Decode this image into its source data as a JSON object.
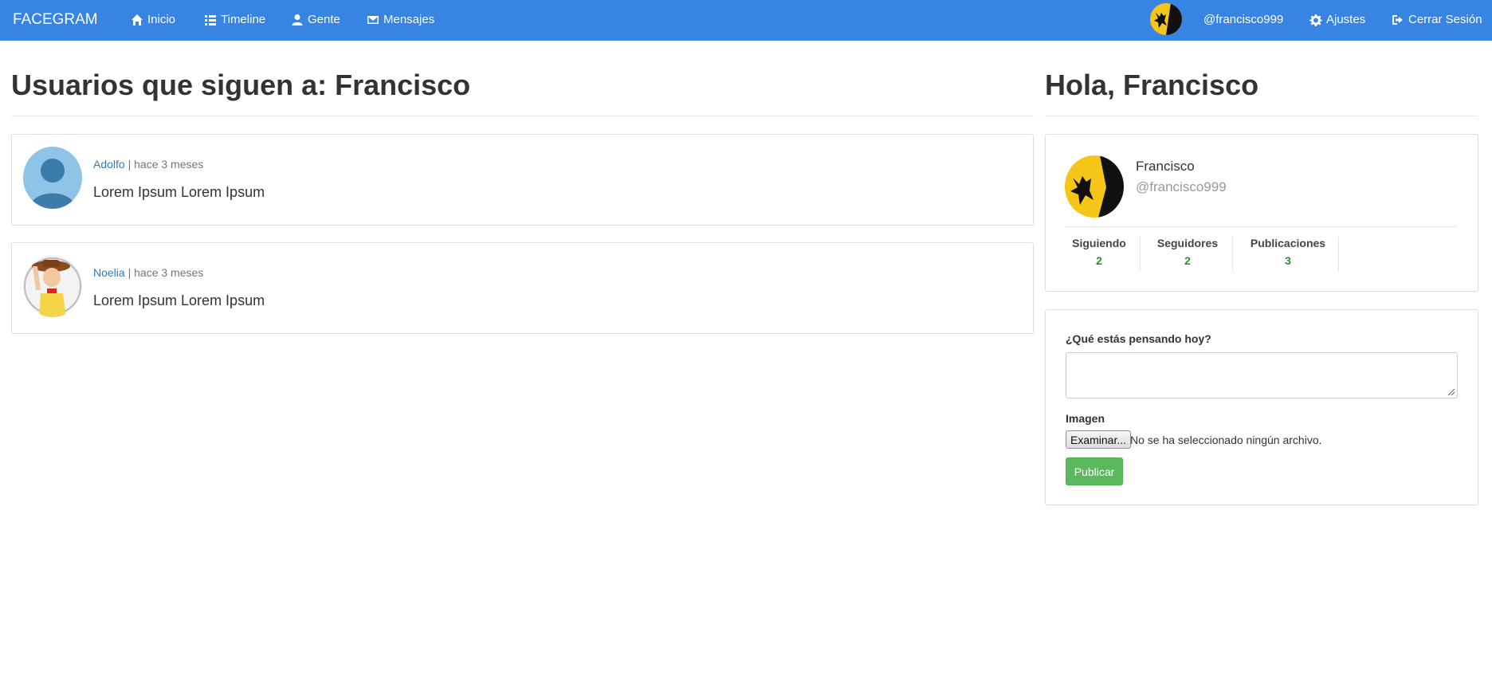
{
  "navbar": {
    "brand": "FACEGRAM",
    "items": [
      {
        "label": "Inicio",
        "icon": "home-icon"
      },
      {
        "label": "Timeline",
        "icon": "list-icon"
      },
      {
        "label": "Gente",
        "icon": "user-icon"
      },
      {
        "label": "Mensajes",
        "icon": "envelope-icon"
      }
    ],
    "username": "@francisco999",
    "settings_label": "Ajustes",
    "logout_label": "Cerrar Sesión",
    "color": "#3784e3"
  },
  "main": {
    "title": "Usuarios que siguen a: Francisco",
    "posts": [
      {
        "author": "Adolfo",
        "separator": "|",
        "time": "hace 3 meses",
        "text": "Lorem Ipsum Lorem Ipsum",
        "avatar": "default-user-avatar"
      },
      {
        "author": "Noelia",
        "separator": "|",
        "time": "hace 3 meses",
        "text": "Lorem Ipsum Lorem Ipsum",
        "avatar": "cowboy-avatar"
      }
    ]
  },
  "sidebar": {
    "greeting": "Hola, Francisco",
    "profile": {
      "name": "Francisco",
      "handle": "@francisco999",
      "stats": [
        {
          "label": "Siguiendo",
          "value": "2"
        },
        {
          "label": "Seguidores",
          "value": "2"
        },
        {
          "label": "Publicaciones",
          "value": "3"
        }
      ]
    },
    "form": {
      "question_label": "¿Qué estás pensando hoy?",
      "textarea_value": "",
      "image_label": "Imagen",
      "file_button": "Examinar...",
      "file_status": "No se ha seleccionado ningún archivo.",
      "submit_label": "Publicar"
    }
  },
  "colors": {
    "stat_value": "#2e8b2e",
    "link": "#337ab7",
    "publish": "#5cb85c"
  }
}
